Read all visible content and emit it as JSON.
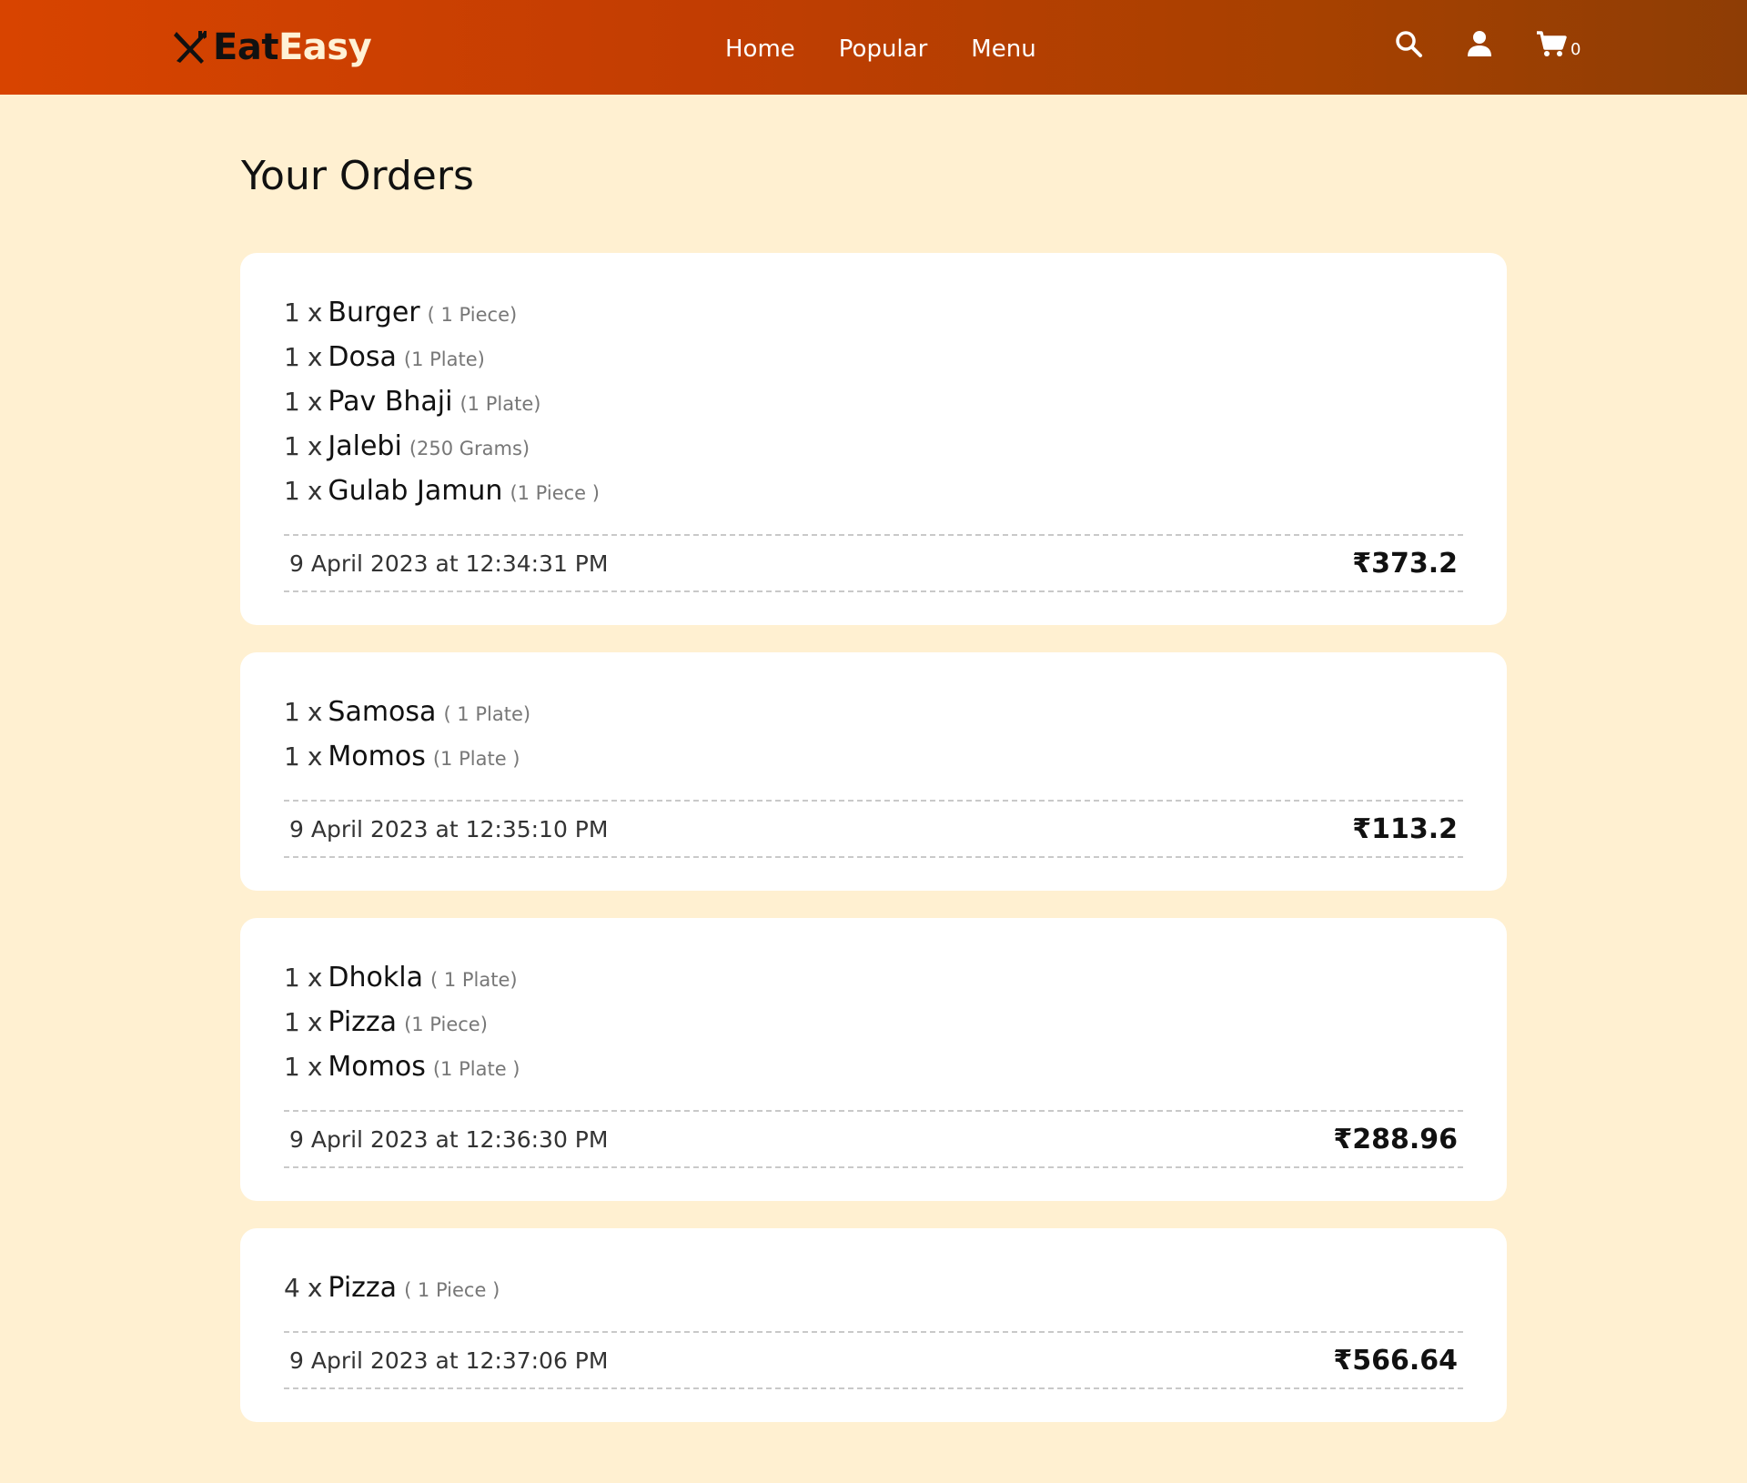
{
  "brand": {
    "part1": "Eat",
    "part2": "Easy"
  },
  "nav": {
    "links": [
      "Home",
      "Popular",
      "Menu"
    ],
    "icons": [
      "search-icon",
      "user-icon",
      "cart-icon"
    ],
    "cart_count": "0"
  },
  "colors": {
    "header_gradient_start": "#d84400",
    "header_gradient_end": "#8e3d05",
    "page_background": "#fff0d1",
    "card_background": "#ffffff"
  },
  "page": {
    "title": "Your Orders"
  },
  "orders": [
    {
      "items": [
        {
          "qty": "1",
          "name": "Burger",
          "portion": "( 1 Piece)"
        },
        {
          "qty": "1",
          "name": "Dosa",
          "portion": "(1 Plate)"
        },
        {
          "qty": "1",
          "name": "Pav Bhaji",
          "portion": "(1 Plate)"
        },
        {
          "qty": "1",
          "name": "Jalebi",
          "portion": "(250 Grams)"
        },
        {
          "qty": "1",
          "name": "Gulab Jamun",
          "portion": "(1 Piece )"
        }
      ],
      "date": "9 April 2023 at 12:34:31 PM",
      "total": "₹373.2"
    },
    {
      "items": [
        {
          "qty": "1",
          "name": "Samosa",
          "portion": "( 1 Plate)"
        },
        {
          "qty": "1",
          "name": "Momos",
          "portion": "(1 Plate )"
        }
      ],
      "date": "9 April 2023 at 12:35:10 PM",
      "total": "₹113.2"
    },
    {
      "items": [
        {
          "qty": "1",
          "name": "Dhokla",
          "portion": "( 1 Plate)"
        },
        {
          "qty": "1",
          "name": "Pizza",
          "portion": "(1 Piece)"
        },
        {
          "qty": "1",
          "name": "Momos",
          "portion": "(1 Plate )"
        }
      ],
      "date": "9 April 2023 at 12:36:30 PM",
      "total": "₹288.96"
    },
    {
      "items": [
        {
          "qty": "4",
          "name": "Pizza",
          "portion": "( 1 Piece )"
        }
      ],
      "date": "9 April 2023 at 12:37:06 PM",
      "total": "₹566.64"
    }
  ]
}
